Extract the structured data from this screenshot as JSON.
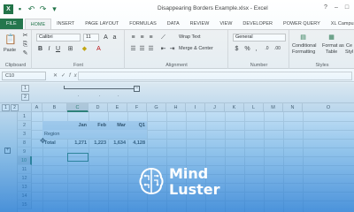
{
  "window": {
    "title": "Disappearing Borders Example.xlsx - Excel",
    "app_icon": "X",
    "qat_icons": [
      "save-icon",
      "undo-icon",
      "redo-icon",
      "customize-icon"
    ]
  },
  "tabs": [
    {
      "label": "FILE"
    },
    {
      "label": "HOME"
    },
    {
      "label": "INSERT"
    },
    {
      "label": "PAGE LAYOUT"
    },
    {
      "label": "FORMULAS"
    },
    {
      "label": "DATA"
    },
    {
      "label": "REVIEW"
    },
    {
      "label": "VIEW"
    },
    {
      "label": "DEVELOPER"
    },
    {
      "label": "POWER QUERY"
    },
    {
      "label": "XL Campus"
    }
  ],
  "ribbon": {
    "clipboard": {
      "paste_label": "Paste",
      "group_label": "Clipboard"
    },
    "font": {
      "font_name": "Calibri",
      "font_size": "11",
      "group_label": "Font"
    },
    "alignment": {
      "wrap_text": "Wrap Text",
      "merge_center": "Merge & Center",
      "group_label": "Alignment"
    },
    "number": {
      "format": "General",
      "currency": "$",
      "percent": "%",
      "comma": ",",
      "group_label": "Number"
    },
    "styles": {
      "conditional_l1": "Conditional",
      "conditional_l2": "Formatting",
      "format_as_l1": "Format as",
      "format_as_l2": "Table",
      "cell_styles_l1": "Ce",
      "cell_styles_l2": "Styl",
      "group_label": "Styles"
    }
  },
  "formula_bar": {
    "name_box": "C10",
    "fx": "fx"
  },
  "outline": {
    "levels": [
      "1",
      "2",
      "3"
    ],
    "row_levels": [
      "1",
      "2"
    ],
    "collapse_symbol": "−",
    "expand_symbol": "+"
  },
  "grid": {
    "columns": [
      "A",
      "B",
      "C",
      "D",
      "E",
      "F",
      "G",
      "H",
      "I",
      "J",
      "K",
      "L",
      "M",
      "N",
      "O"
    ],
    "rows": [
      "1",
      "2",
      "3",
      "8",
      "9",
      "10",
      "11",
      "12",
      "13",
      "14",
      "15",
      "16"
    ],
    "header_row": {
      "jan": "Jan",
      "feb": "Feb",
      "mar": "Mar",
      "q1": "Q1"
    },
    "region_label": "Region",
    "total_row": {
      "label": "Total",
      "jan": "1,271",
      "feb": "1,223",
      "mar": "1,634",
      "q1": "4,128"
    }
  },
  "watermark": {
    "line1": "Mind",
    "line2": "Luster"
  }
}
